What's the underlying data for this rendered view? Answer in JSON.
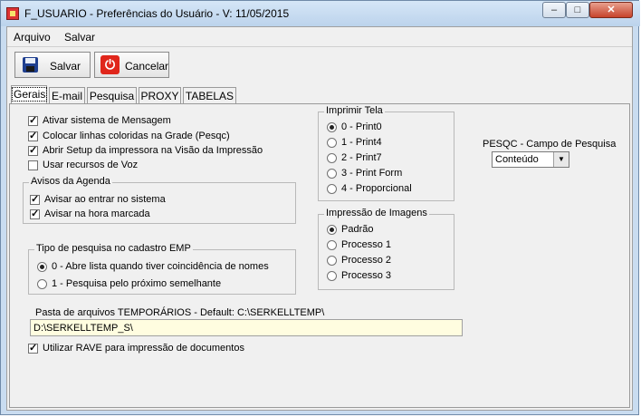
{
  "window": {
    "title": "F_USUARIO - Preferências do Usuário - V: 11/05/2015",
    "minimize": "–",
    "maximize": "□",
    "close": "✕"
  },
  "menu": {
    "arquivo": "Arquivo",
    "salvar": "Salvar"
  },
  "toolbar": {
    "save_label": "Salvar",
    "cancel_label": "Cancelar"
  },
  "tabs": [
    "Gerais",
    "E-mail",
    "Pesquisa",
    "PROXY",
    "TABELAS"
  ],
  "active_tab": "Gerais",
  "general": {
    "options": [
      {
        "label": "Ativar sistema de Mensagem",
        "checked": true
      },
      {
        "label": "Colocar linhas coloridas na Grade (Pesqc)",
        "checked": true
      },
      {
        "label": "Abrir Setup da impressora na Visão da Impressão",
        "checked": true
      },
      {
        "label": "Usar recursos de Voz",
        "checked": false
      }
    ],
    "avisos": {
      "title": "Avisos da Agenda",
      "items": [
        {
          "label": "Avisar ao entrar no sistema",
          "checked": true
        },
        {
          "label": "Avisar na hora marcada",
          "checked": true
        }
      ]
    },
    "tipo_pesquisa": {
      "title": "Tipo de pesquisa no cadastro EMP",
      "items": [
        {
          "label": "0 - Abre lista quando tiver coincidência de nomes",
          "selected": true
        },
        {
          "label": "1 - Pesquisa pelo próximo semelhante",
          "selected": false
        }
      ]
    },
    "pasta": {
      "label": "Pasta de arquivos TEMPORÁRIOS - Default: C:\\SERKELLTEMP\\",
      "value": "D:\\SERKELLTEMP_S\\"
    },
    "rave": {
      "label": "Utilizar RAVE para impressão de documentos",
      "checked": true
    }
  },
  "imprimir_tela": {
    "title": "Imprimir Tela",
    "items": [
      {
        "label": "0 - Print0",
        "selected": true
      },
      {
        "label": "1 - Print4",
        "selected": false
      },
      {
        "label": "2 - Print7",
        "selected": false
      },
      {
        "label": "3 - Print Form",
        "selected": false
      },
      {
        "label": "4 - Proporcional",
        "selected": false
      }
    ]
  },
  "impressao_imagens": {
    "title": "Impressão de Imagens",
    "items": [
      {
        "label": "Padrão",
        "selected": true
      },
      {
        "label": "Processo 1",
        "selected": false
      },
      {
        "label": "Processo 2",
        "selected": false
      },
      {
        "label": "Processo 3",
        "selected": false
      }
    ]
  },
  "pesqc": {
    "label": "PESQC - Campo de Pesquisa",
    "value": "Conteúdo"
  },
  "colors": {
    "titlebar": "#c9dcf0",
    "close_button": "#c7432b",
    "input_bg": "#fffde0"
  }
}
